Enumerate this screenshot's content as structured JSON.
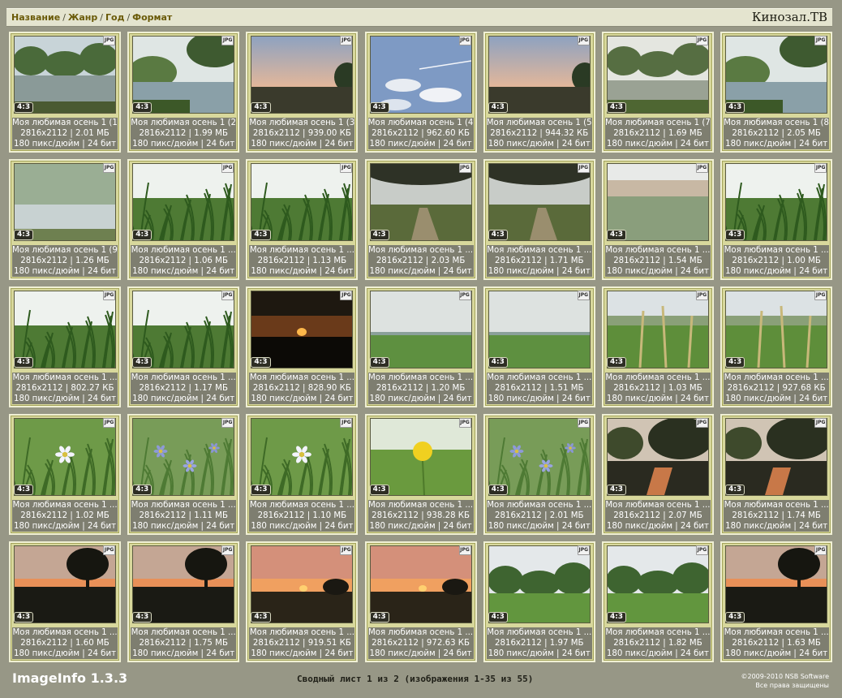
{
  "header": {
    "breadcrumb": [
      "Название",
      "Жанр",
      "Год",
      "Формат"
    ],
    "site_title": "Кинозал.ТВ"
  },
  "badges": {
    "format": "JPG",
    "aspect": "4:3"
  },
  "images": [
    {
      "title": "Моя любимая осень 1 (1)",
      "dims": "2816x2112 | 2.01 МБ",
      "res": "180 пикс/дюйм | 24 бит",
      "scene": "pond-trees"
    },
    {
      "title": "Моя любимая осень 1 (2)",
      "dims": "2816x2112 | 1.99 МБ",
      "res": "180 пикс/дюйм | 24 бит",
      "scene": "pond-branches"
    },
    {
      "title": "Моя любимая осень 1 (3)",
      "dims": "2816x2112 | 939.00 КБ",
      "res": "180 пикс/дюйм | 24 бит",
      "scene": "dawn-field"
    },
    {
      "title": "Моя любимая осень 1 (4)",
      "dims": "2816x2112 | 962.60 КБ",
      "res": "180 пикс/дюйм | 24 бит",
      "scene": "sky-clouds"
    },
    {
      "title": "Моя любимая осень 1 (5)",
      "dims": "2816x2112 | 944.32 КБ",
      "res": "180 пикс/дюйм | 24 бит",
      "scene": "dawn-field"
    },
    {
      "title": "Моя любимая осень 1 (7)",
      "dims": "2816x2112 | 1.69 МБ",
      "res": "180 пикс/дюйм | 24 бит",
      "scene": "misty-trees"
    },
    {
      "title": "Моя любимая осень 1 (8)",
      "dims": "2816x2112 | 2.05 МБ",
      "res": "180 пикс/дюйм | 24 бит",
      "scene": "pond-branches"
    },
    {
      "title": "Моя любимая осень 1 (9)",
      "dims": "2816x2112 | 1.26 МБ",
      "res": "180 пикс/дюйм | 24 бит",
      "scene": "misty-pond"
    },
    {
      "title": "Моя любимая осень 1 ...",
      "dims": "2816x2112 | 1.06 МБ",
      "res": "180 пикс/дюйм | 24 бит",
      "scene": "grass"
    },
    {
      "title": "Моя любимая осень 1 ...",
      "dims": "2816x2112 | 1.13 МБ",
      "res": "180 пикс/дюйм | 24 бит",
      "scene": "grass"
    },
    {
      "title": "Моя любимая осень 1 ...",
      "dims": "2816x2112 | 2.03 МБ",
      "res": "180 пикс/дюйм | 24 бит",
      "scene": "tree-path"
    },
    {
      "title": "Моя любимая осень 1 ...",
      "dims": "2816x2112 | 1.71 МБ",
      "res": "180 пикс/дюйм | 24 бит",
      "scene": "tree-path"
    },
    {
      "title": "Моя любимая осень 1 ...",
      "dims": "2816x2112 | 1.54 МБ",
      "res": "180 пикс/дюйм | 24 бит",
      "scene": "misty-meadow"
    },
    {
      "title": "Моя любимая осень 1 ...",
      "dims": "2816x2112 | 1.00 МБ",
      "res": "180 пикс/дюйм | 24 бит",
      "scene": "grass"
    },
    {
      "title": "Моя любимая осень 1 ...",
      "dims": "2816x2112 | 802.27 КБ",
      "res": "180 пикс/дюйм | 24 бит",
      "scene": "grass"
    },
    {
      "title": "Моя любимая осень 1 ...",
      "dims": "2816x2112 | 1.17 МБ",
      "res": "180 пикс/дюйм | 24 бит",
      "scene": "grass"
    },
    {
      "title": "Моя любимая осень 1 ...",
      "dims": "2816x2112 | 828.90 КБ",
      "res": "180 пикс/дюйм | 24 бит",
      "scene": "sunset-dark"
    },
    {
      "title": "Моя любимая осень 1 ...",
      "dims": "2816x2112 | 1.20 МБ",
      "res": "180 пикс/дюйм | 24 бит",
      "scene": "green-field"
    },
    {
      "title": "Моя любимая осень 1 ...",
      "dims": "2816x2112 | 1.51 МБ",
      "res": "180 пикс/дюйм | 24 бит",
      "scene": "green-field"
    },
    {
      "title": "Моя любимая осень 1 ...",
      "dims": "2816x2112 | 1.03 МБ",
      "res": "180 пикс/дюйм | 24 бит",
      "scene": "meadow-stalks"
    },
    {
      "title": "Моя любимая осень 1 ...",
      "dims": "2816x2112 | 927.68 КБ",
      "res": "180 пикс/дюйм | 24 бит",
      "scene": "meadow-stalks"
    },
    {
      "title": "Моя любимая осень 1 ...",
      "dims": "2816x2112 | 1.02 МБ",
      "res": "180 пикс/дюйм | 24 бит",
      "scene": "flower-white"
    },
    {
      "title": "Моя любимая осень 1 ...",
      "dims": "2816x2112 | 1.11 МБ",
      "res": "180 пикс/дюйм | 24 бит",
      "scene": "flower-blue"
    },
    {
      "title": "Моя любимая осень 1 ...",
      "dims": "2816x2112 | 1.10 МБ",
      "res": "180 пикс/дюйм | 24 бит",
      "scene": "flower-white"
    },
    {
      "title": "Моя любимая осень 1 ...",
      "dims": "2816x2112 | 938.28 КБ",
      "res": "180 пикс/дюйм | 24 бит",
      "scene": "flower-yellow"
    },
    {
      "title": "Моя любимая осень 1 ...",
      "dims": "2816x2112 | 2.01 МБ",
      "res": "180 пикс/дюйм | 24 бит",
      "scene": "flower-blue"
    },
    {
      "title": "Моя любимая осень 1 ...",
      "dims": "2816x2112 | 2.07 МБ",
      "res": "180 пикс/дюйм | 24 бит",
      "scene": "sunset-pond"
    },
    {
      "title": "Моя любимая осень 1 ...",
      "dims": "2816x2112 | 1.74 МБ",
      "res": "180 пикс/дюйм | 24 бит",
      "scene": "sunset-pond"
    },
    {
      "title": "Моя любимая осень 1 ...",
      "dims": "2816x2112 | 1.60 МБ",
      "res": "180 пикс/дюйм | 24 бит",
      "scene": "sunset-tree"
    },
    {
      "title": "Моя любимая осень 1 ...",
      "dims": "2816x2112 | 1.75 МБ",
      "res": "180 пикс/дюйм | 24 бит",
      "scene": "sunset-tree"
    },
    {
      "title": "Моя любимая осень 1 ...",
      "dims": "2816x2112 | 919.51 КБ",
      "res": "180 пикс/дюйм | 24 бит",
      "scene": "sunset-orange"
    },
    {
      "title": "Моя любимая осень 1 ...",
      "dims": "2816x2112 | 972.63 КБ",
      "res": "180 пикс/дюйм | 24 бит",
      "scene": "sunset-orange"
    },
    {
      "title": "Моя любимая осень 1 ...",
      "dims": "2816x2112 | 1.97 МБ",
      "res": "180 пикс/дюйм | 24 бит",
      "scene": "green-trees"
    },
    {
      "title": "Моя любимая осень 1 ...",
      "dims": "2816x2112 | 1.82 МБ",
      "res": "180 пикс/дюйм | 24 бит",
      "scene": "green-trees"
    },
    {
      "title": "Моя любимая осень 1 ...",
      "dims": "2816x2112 | 1.63 МБ",
      "res": "180 пикс/дюйм | 24 бит",
      "scene": "sunset-tree"
    }
  ],
  "footer": {
    "brand": "ImageInfo 1.3.3",
    "status": "Сводный лист 1 из 2 (изображения 1-35 из 55)",
    "copyright": "©2009-2010 NSB Software",
    "rights": "Все права защищены"
  },
  "colors": {
    "page_background": "#979786",
    "card_background": "#d8d89c",
    "header_background": "#e4e4cf",
    "breadcrumb_text": "#6a5a08"
  }
}
